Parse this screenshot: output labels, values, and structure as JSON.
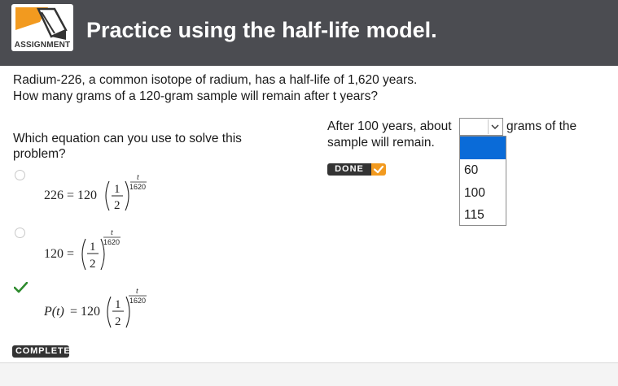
{
  "header": {
    "logo_label": "ASSIGNMENT",
    "title": "Practice using the half-life model."
  },
  "question": {
    "line1": "Radium-226, a common isotope of radium, has a half-life of 1,620 years.",
    "line2": "How many grams of a 120-gram sample will remain after t years?"
  },
  "left": {
    "prompt": "Which equation can you use to solve this problem?",
    "options": [
      {
        "lhs": "226",
        "coef": "120",
        "num": "1",
        "den": "2",
        "exp_num": "t",
        "exp_den": "1620",
        "selected": false
      },
      {
        "lhs": "120",
        "coef": "",
        "num": "1",
        "den": "2",
        "exp_num": "t",
        "exp_den": "1620",
        "selected": false
      },
      {
        "lhs": "P(t)",
        "coef": "120",
        "num": "1",
        "den": "2",
        "exp_num": "t",
        "exp_den": "1620",
        "selected": true
      }
    ],
    "status_badge": "COMPLETE"
  },
  "right": {
    "text_before": "After 100 years, about",
    "text_after": "grams of the",
    "text_line2": "sample will remain.",
    "select_value": "",
    "dropdown_options": [
      "",
      "60",
      "100",
      "115"
    ],
    "done_label": "DONE"
  },
  "colors": {
    "header_bg": "#4b4c51",
    "accent_orange": "#f29a1f",
    "highlight_blue": "#0a6bd8",
    "check_green": "#2e8b2e"
  },
  "icons": {
    "logo": "pencil-logo-icon",
    "check": "checkmark-icon",
    "dropdown": "chevron-down-icon",
    "done": "check-box-icon"
  }
}
